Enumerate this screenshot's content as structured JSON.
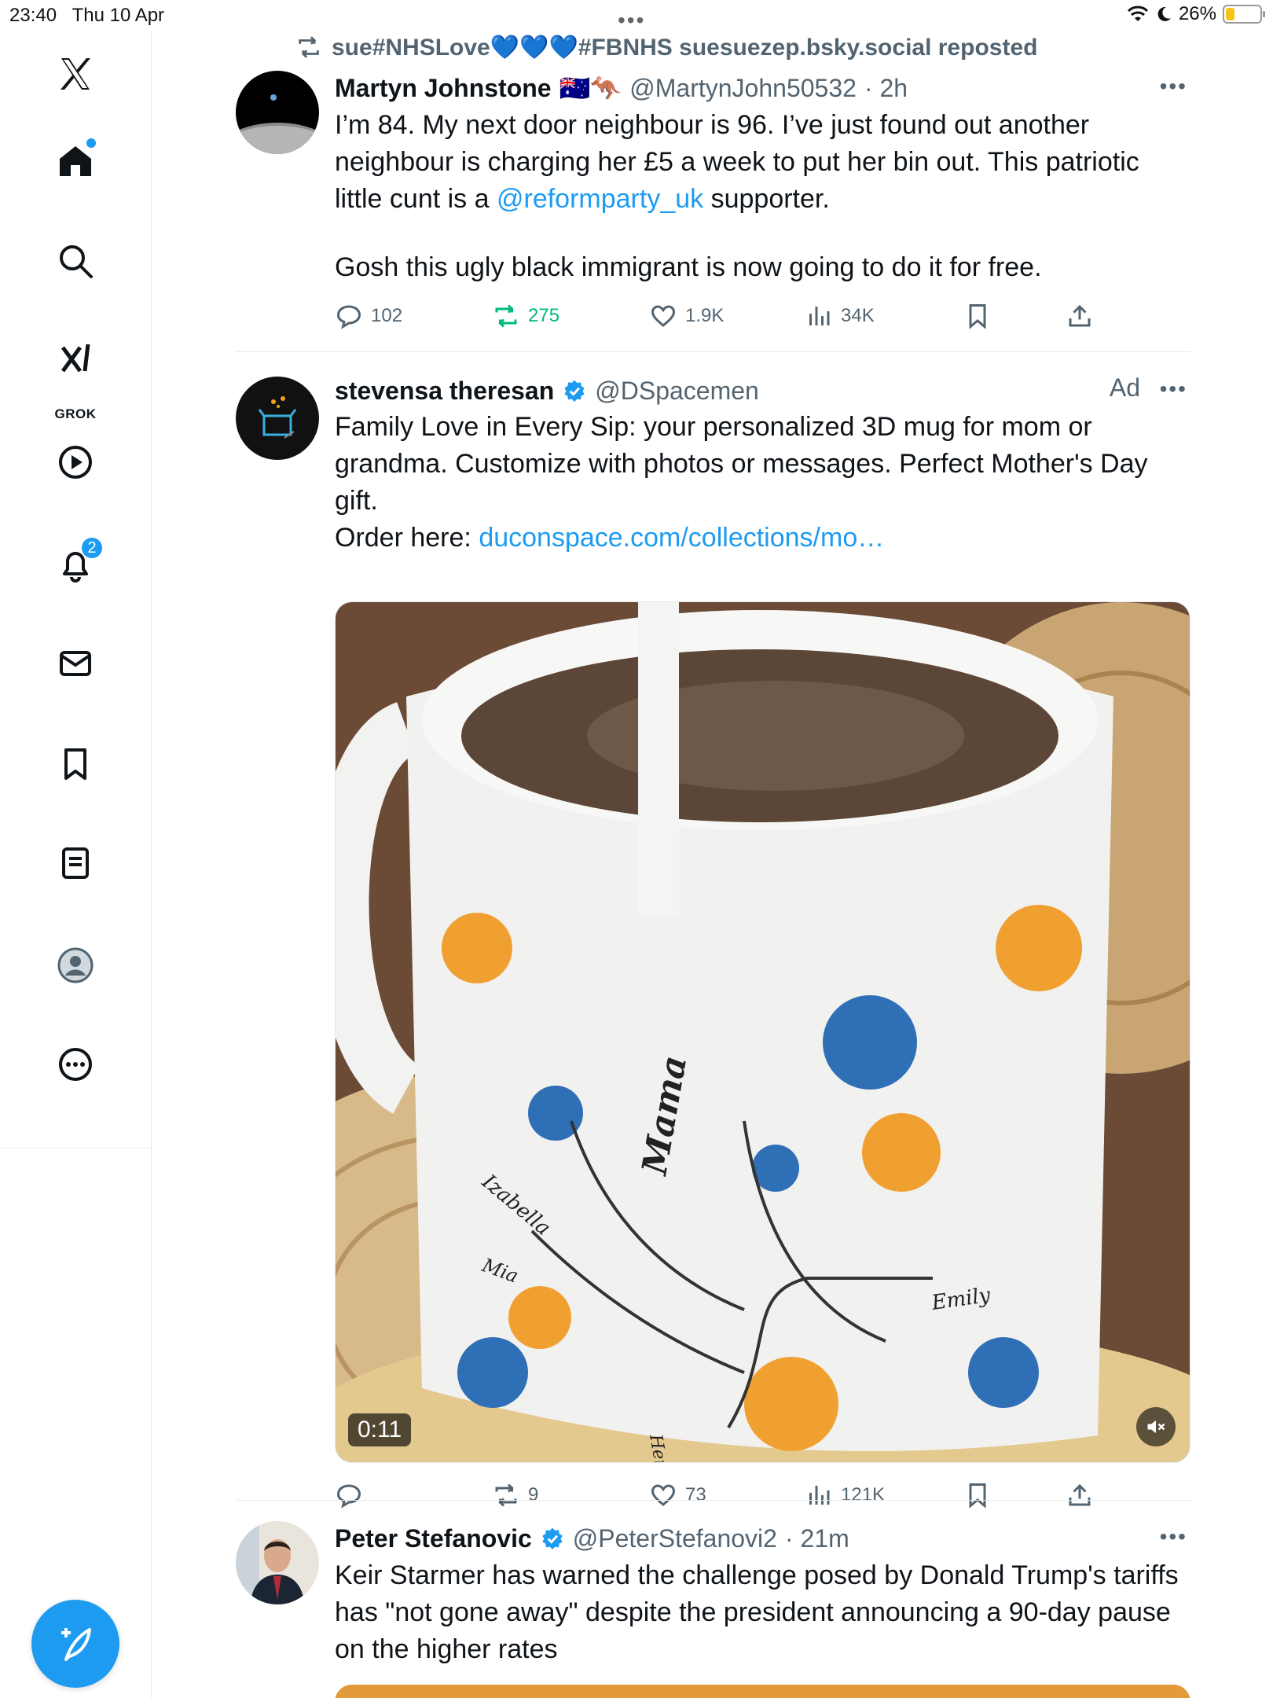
{
  "status": {
    "time": "23:40",
    "date": "Thu 10 Apr",
    "battery": "26%",
    "battery_level": 0.26
  },
  "sidebar": {
    "grok_label": "GROK",
    "notification_count": "2"
  },
  "feed": {
    "post1": {
      "repost_by": "sue#NHSLove💙💙💙#FBNHS suesuezep.bsky.social reposted",
      "name": "Martyn Johnstone",
      "flag": "🇦🇺🦘",
      "handle": "@MartynJohn50532",
      "time": "· 2h",
      "text_a": "I’m 84. My next door neighbour is 96. I’ve just found out another neighbour is charging her £5 a week to put her bin out. This patriotic little cunt is a ",
      "mention": "@reformparty_uk",
      "text_b": " supporter.",
      "text_c": "Gosh this ugly black immigrant is now going to do it for free.",
      "replies": "102",
      "reposts": "275",
      "likes": "1.9K",
      "views": "34K"
    },
    "post2": {
      "name": "stevensa theresan",
      "handle": "@DSpacemen",
      "ad": "Ad",
      "text_a": "Family Love in Every Sip: your personalized 3D mug for mom or grandma. Customize with photos or messages. Perfect Mother's Day gift.",
      "order_label": "Order here: ",
      "link": "duconspace.com/collections/mo…",
      "video_time": "0:11",
      "mug_names": [
        "Mama",
        "Izabella",
        "Mia",
        "Emily",
        "Henry"
      ],
      "replies": "",
      "reposts": "9",
      "likes": "73",
      "views": "121K"
    },
    "post3": {
      "name": "Peter Stefanovic",
      "handle": "@PeterStefanovi2",
      "time": "· 21m",
      "text_a": "Keir Starmer has warned the challenge posed by Donald Trump's tariffs has \"not gone away\" despite the president announcing a 90-day pause on the higher rates"
    }
  },
  "colors": {
    "accent": "#1d9bf0",
    "repost_green": "#00ba7c",
    "secondary": "#536471"
  },
  "icons": [
    "x-logo-icon",
    "home-icon",
    "search-icon",
    "grok-icon",
    "video-icon",
    "bell-icon",
    "mail-icon",
    "bookmark-icon",
    "list-icon",
    "profile-icon",
    "more-icon",
    "compose-icon",
    "reply-icon",
    "repost-icon",
    "like-icon",
    "views-icon",
    "share-icon",
    "mute-icon",
    "verified-icon"
  ]
}
